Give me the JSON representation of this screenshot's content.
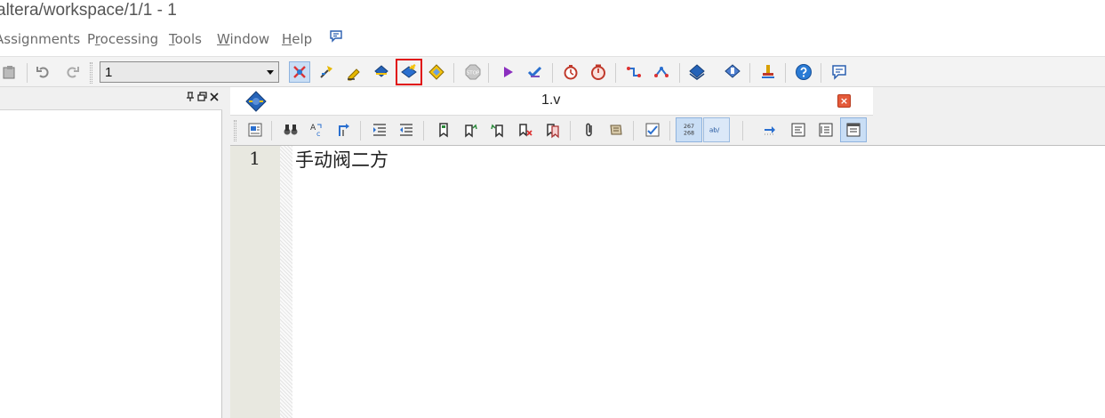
{
  "window": {
    "title": "altera/workspace/1/1 - 1"
  },
  "menu": {
    "items": [
      {
        "label": "Assignments",
        "mnemonic_index": -1
      },
      {
        "label": "Processing",
        "mnemonic_index": 1
      },
      {
        "label": "Tools",
        "mnemonic_index": 0
      },
      {
        "label": "Window",
        "mnemonic_index": 0
      },
      {
        "label": "Help",
        "mnemonic_index": 0
      }
    ]
  },
  "toolbar": {
    "revision_value": "1",
    "highlighted_button": "start-analysis-synthesis-button",
    "highlight_color": "#e01010",
    "icons": [
      "paste-icon",
      "undo-icon",
      "redo-icon",
      "project-navigator-icon",
      "pin-planner-icon",
      "assignment-editor-icon",
      "start-analysis-elaboration-icon",
      "start-analysis-synthesis-icon",
      "start-fitter-icon",
      "stop-icon",
      "start-compilation-icon",
      "analysis-synthesis-check-icon",
      "timing-analyzer-icon",
      "timequest-icon",
      "chip-planner-icon",
      "rtl-viewer-icon",
      "programmer-icon",
      "assembler-icon",
      "signaltap-icon",
      "help-icon",
      "whats-this-icon"
    ]
  },
  "left_panel": {
    "controls": [
      "pin-icon",
      "restore-icon",
      "close-icon"
    ]
  },
  "document": {
    "tab_title": "1.v",
    "close_glyph": "×",
    "line_numbers": [
      "1"
    ],
    "lines": [
      "手动阀二方"
    ]
  }
}
